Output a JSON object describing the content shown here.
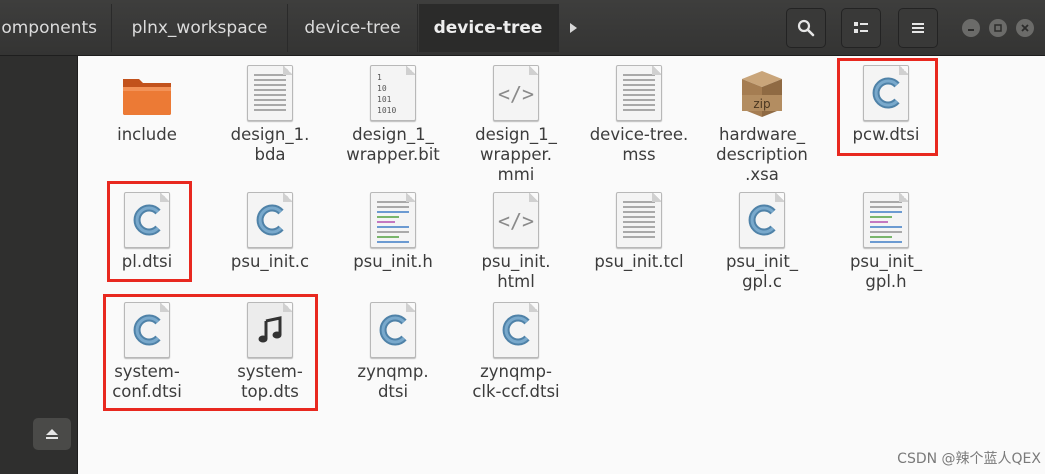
{
  "breadcrumbs": [
    {
      "label": "omponents",
      "active": false
    },
    {
      "label": "plnx_workspace",
      "active": false
    },
    {
      "label": "device-tree",
      "active": false
    },
    {
      "label": "device-tree",
      "active": true
    }
  ],
  "header_icons": [
    "search-icon",
    "list-view-icon",
    "menu-icon",
    "minimize-icon",
    "maximize-icon",
    "close-icon"
  ],
  "sidebar": {
    "eject_icon": "eject-icon"
  },
  "files": [
    {
      "name": "include",
      "icon": "folder-icon"
    },
    {
      "name": "design_1.\nbda",
      "icon": "text-file-icon"
    },
    {
      "name": "design_1_\nwrapper.bit",
      "icon": "binary-file-icon"
    },
    {
      "name": "design_1_\nwrapper.\nmmi",
      "icon": "code-file-icon"
    },
    {
      "name": "device-tree.\nmss",
      "icon": "text-file-icon"
    },
    {
      "name": "hardware_\ndescription\n.xsa",
      "icon": "zip-archive-icon"
    },
    {
      "name": "pcw.dtsi",
      "icon": "c-source-icon",
      "highlighted": true
    },
    {
      "name": "pl.dtsi",
      "icon": "c-source-icon",
      "highlighted": true
    },
    {
      "name": "psu_init.c",
      "icon": "c-source-icon"
    },
    {
      "name": "psu_init.h",
      "icon": "c-header-icon"
    },
    {
      "name": "psu_init.\nhtml",
      "icon": "code-file-icon"
    },
    {
      "name": "psu_init.tcl",
      "icon": "text-file-icon"
    },
    {
      "name": "psu_init_\ngpl.c",
      "icon": "c-source-icon"
    },
    {
      "name": "psu_init_\ngpl.h",
      "icon": "c-header-icon"
    },
    {
      "name": "system-\nconf.dtsi",
      "icon": "c-source-icon",
      "highlighted": true
    },
    {
      "name": "system-\ntop.dts",
      "icon": "audio-file-icon",
      "highlighted": true
    },
    {
      "name": "zynqmp.\ndtsi",
      "icon": "c-source-icon"
    },
    {
      "name": "zynqmp-\nclk-ccf.dtsi",
      "icon": "c-source-icon"
    }
  ],
  "binary_glyph": "1\n10\n101\n1010",
  "code_glyph": "</>",
  "zip_glyph": "zip",
  "watermark": "CSDN @辣个蓝人QEX",
  "colors": {
    "highlight": "#e8281f",
    "header": "#3e3e3d",
    "sidebar": "#2f2f2e"
  }
}
